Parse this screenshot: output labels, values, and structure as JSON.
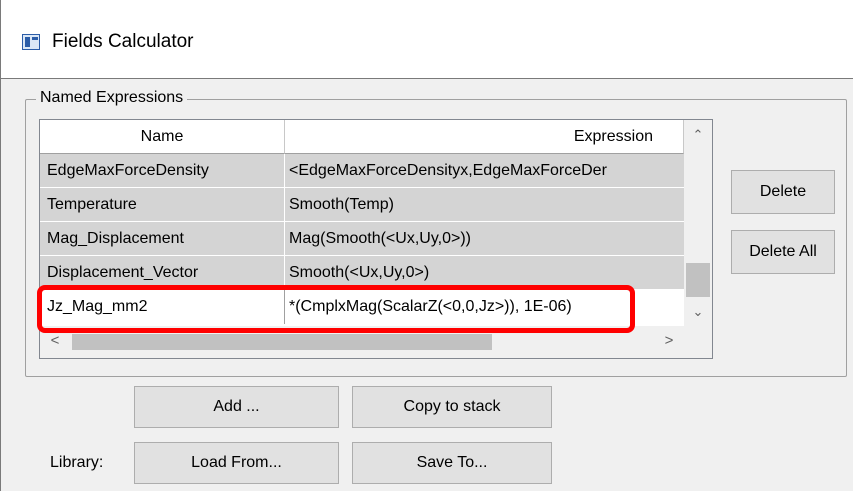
{
  "window": {
    "title": "Fields Calculator",
    "icon": "calculator-window-icon"
  },
  "group": {
    "label": "Named Expressions"
  },
  "table": {
    "columns": [
      "Name",
      "Expression"
    ],
    "rows": [
      {
        "name": "EdgeMaxForceDensity",
        "expression": "<EdgeMaxForceDensityx,EdgeMaxForceDer"
      },
      {
        "name": "Temperature",
        "expression": "Smooth(Temp)"
      },
      {
        "name": "Mag_Displacement",
        "expression": "Mag(Smooth(<Ux,Uy,0>))"
      },
      {
        "name": "Displacement_Vector",
        "expression": "Smooth(<Ux,Uy,0>)"
      },
      {
        "name": "Jz_Mag_mm2",
        "expression": "*(CmplxMag(ScalarZ(<0,0,Jz>)), 1E-06)"
      }
    ],
    "selected_row": 4
  },
  "scrollbars": {
    "up": "⌃",
    "down": "⌄",
    "left": "<",
    "right": ">"
  },
  "buttons": {
    "delete": "Delete",
    "delete_all": "Delete All",
    "add": "Add ...",
    "copy_to_stack": "Copy to stack",
    "load_from": "Load From...",
    "save_to": "Save To..."
  },
  "library_label": "Library:",
  "colors": {
    "highlight": "#ff0000",
    "row_bg": "#d4d4d4",
    "dialog_bg": "#f0f0f0"
  }
}
